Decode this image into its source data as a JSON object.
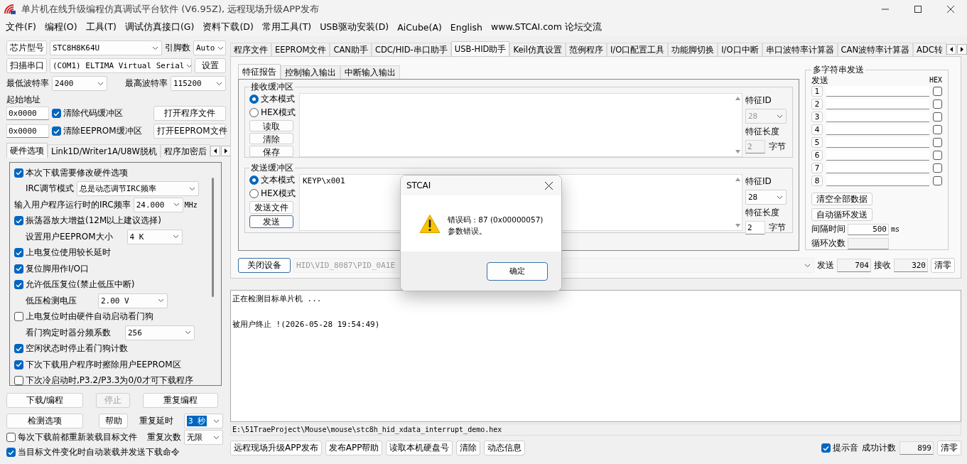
{
  "window": {
    "title": "单片机在线升级编程仿真调试平台软件 (V6.95Z), 远程现场升级APP发布"
  },
  "menu": [
    "文件(F)",
    "编程(O)",
    "工具(T)",
    "调试仿真接口(G)",
    "资料下载(D)",
    "常用工具(T)",
    "USB驱动安装(D)",
    "AiCube(A)",
    "English",
    "www.STCAI.com 论坛交流"
  ],
  "left": {
    "rows": [
      [
        {
          "kind": "button",
          "label": "芯片型号"
        },
        {
          "kind": "select",
          "value": "STC8H8K64U"
        },
        {
          "kind": "label",
          "text": "引脚数"
        },
        {
          "kind": "select",
          "value": "Auto"
        }
      ],
      [
        {
          "kind": "button",
          "label": "扫描串口"
        },
        {
          "kind": "select",
          "value": "(COM1) ELTIMA Virtual Serial"
        },
        {
          "kind": "button",
          "label": "设置"
        }
      ],
      [
        {
          "kind": "label",
          "text": "最低波特率"
        },
        {
          "kind": "select",
          "value": "2400"
        },
        {
          "kind": "label",
          "text": "最高波特率"
        },
        {
          "kind": "select",
          "value": "115200"
        }
      ],
      [
        {
          "kind": "label",
          "text": "起始地址"
        }
      ],
      [
        {
          "kind": "input",
          "value": "0x0000"
        },
        {
          "kind": "check",
          "label": "清除代码缓冲区",
          "checked": true
        },
        {
          "kind": "button",
          "label": "打开程序文件"
        }
      ],
      [
        {
          "kind": "input",
          "value": "0x0000"
        },
        {
          "kind": "check",
          "label": "清除EEPROM缓冲区",
          "checked": true
        },
        {
          "kind": "button",
          "label": "打开EEPROM文件"
        }
      ]
    ],
    "tabs": [
      {
        "label": "硬件选项",
        "selected": true
      },
      {
        "label": "Link1D/Writer1A/U8W脱机",
        "selected": false
      },
      {
        "label": "程序加密后",
        "selected": false
      }
    ],
    "options": [
      {
        "kind": "check",
        "label": "本次下载需要修改硬件选项",
        "checked": true
      },
      {
        "kind": "select",
        "label": "IRC调节模式",
        "value": "总是动态调节IRC频率"
      },
      {
        "kind": "select",
        "label": "输入用户程序运行时的IRC频率",
        "value": "24.000",
        "unit": "MHz"
      },
      {
        "kind": "check",
        "label": "振荡器放大增益(12M以上建议选择)",
        "checked": true
      },
      {
        "kind": "select",
        "label": "设置用户EEPROM大小",
        "value": "4   K"
      },
      {
        "kind": "check",
        "label": "上电复位使用较长延时",
        "checked": true
      },
      {
        "kind": "check",
        "label": "复位脚用作I/O口",
        "checked": true
      },
      {
        "kind": "check",
        "label": "允许低压复位(禁止低压中断)",
        "checked": true
      },
      {
        "kind": "select",
        "label": "低压检测电压",
        "value": "2.00 V"
      },
      {
        "kind": "check",
        "label": "上电复位时由硬件自动启动看门狗",
        "checked": false
      },
      {
        "kind": "select",
        "label": "看门狗定时器分频系数",
        "value": "256"
      },
      {
        "kind": "check",
        "label": "空闲状态时停止看门狗计数",
        "checked": true
      },
      {
        "kind": "check",
        "label": "下次下载用户程序时擦除用户EEPROM区",
        "checked": true
      },
      {
        "kind": "check",
        "label": "下次冷启动时,P3.2/P3.3为0/0才可下载程序",
        "checked": false
      }
    ],
    "actions": [
      [
        {
          "kind": "button",
          "label": "下载/编程",
          "disabled": false
        },
        {
          "kind": "button",
          "label": "停止",
          "disabled": true
        },
        {
          "kind": "button",
          "label": "重复编程",
          "disabled": false
        }
      ],
      [
        {
          "kind": "button",
          "label": "检测选项"
        },
        {
          "kind": "button",
          "label": "帮助"
        },
        {
          "kind": "label",
          "text": "重复延时"
        },
        {
          "kind": "select",
          "value": "3 秒",
          "text_selected": true
        }
      ],
      [
        {
          "kind": "check",
          "label": "每次下载前都重新装载目标文件",
          "checked": false
        },
        {
          "kind": "label",
          "text": "重复次数"
        },
        {
          "kind": "select",
          "value": "无限",
          "text_selected": false
        }
      ],
      [
        {
          "kind": "check",
          "label": "当目标文件变化时自动装载并发送下载命令",
          "checked": true
        }
      ]
    ]
  },
  "right": {
    "tabs": [
      {
        "label": "程序文件",
        "selected": false
      },
      {
        "label": "EEPROM文件",
        "selected": false
      },
      {
        "label": "CAN助手",
        "selected": false
      },
      {
        "label": "CDC/HID-串口助手",
        "selected": false
      },
      {
        "label": "USB-HID助手",
        "selected": true
      },
      {
        "label": "Keil仿真设置",
        "selected": false
      },
      {
        "label": "范例程序",
        "selected": false
      },
      {
        "label": "I/O口配置工具",
        "selected": false
      },
      {
        "label": "功能脚切换",
        "selected": false
      },
      {
        "label": "I/O口中断",
        "selected": false
      },
      {
        "label": "串口波特率计算器",
        "selected": false
      },
      {
        "label": "CAN波特率计算器",
        "selected": false
      },
      {
        "label": "ADC转",
        "selected": false
      }
    ],
    "subtabs": [
      {
        "label": "特征报告",
        "selected": true
      },
      {
        "label": "控制输入输出",
        "selected": false
      },
      {
        "label": "中断输入输出",
        "selected": false
      }
    ],
    "buffers": [
      {
        "title": "接收缓冲区",
        "modes": [
          {
            "label": "文本模式",
            "selected": true
          },
          {
            "label": "HEX模式",
            "selected": false
          }
        ],
        "buttons": [
          {
            "label": "读取",
            "default": false
          },
          {
            "label": "清除",
            "default": false
          },
          {
            "label": "保存",
            "default": false
          }
        ],
        "id_label": "特征ID",
        "id": {
          "value": "28",
          "disabled": true
        },
        "len_label": "特征长度",
        "len": {
          "value": "2",
          "disabled": true
        },
        "unit": "字节"
      },
      {
        "title": "发送缓冲区",
        "modes": [
          {
            "label": "文本模式",
            "selected": true
          },
          {
            "label": "HEX模式",
            "selected": false
          }
        ],
        "buttons": [
          {
            "label": "发送文件",
            "default": false
          },
          {
            "label": "发送",
            "default": true
          }
        ],
        "content": "KEYP\\x001",
        "id_label": "特征ID",
        "id": {
          "value": "28",
          "disabled": false
        },
        "len_label": "特征长度",
        "len": {
          "value": "2",
          "disabled": false
        },
        "unit": "字节"
      }
    ],
    "multi": {
      "title": "多字符串发送",
      "send_header": "发送",
      "hex_header": "HEX",
      "rows": [
        {
          "number": "1",
          "hex": false
        },
        {
          "number": "2",
          "hex": false
        },
        {
          "number": "3",
          "hex": false
        },
        {
          "number": "4",
          "hex": false
        },
        {
          "number": "5",
          "hex": false
        },
        {
          "number": "6",
          "hex": false
        },
        {
          "number": "7",
          "hex": false
        },
        {
          "number": "8",
          "hex": false
        }
      ],
      "buttons": [
        "清空全部数据",
        "自动循环发送"
      ],
      "interval_label": "间隔时间",
      "interval": "500",
      "interval_unit": "ms",
      "count_label": "循环次数"
    },
    "device": {
      "button": "关闭设备",
      "path": "HID\\VID_8087\\PID_0A1E",
      "sent_label": "发送",
      "sent": "704",
      "recv_label": "接收",
      "recv": "320",
      "reset": "清零"
    },
    "log": [
      "正在检测目标单片机 ...",
      "被用户终止 !(2026-05-28 19:54:49)"
    ],
    "file_path": "E:\\51TraeProject\\Mouse\\mouse\\stc8h_hid_xdata_interrupt_demo.hex",
    "bottom": {
      "buttons": [
        "远程现场升级APP发布",
        "发布APP帮助",
        "读取本机硬盘号",
        "清除",
        "动态信息"
      ],
      "beep": {
        "label": "提示音",
        "checked": true
      },
      "count_label": "成功计数",
      "count": "899",
      "reset": "清零"
    }
  },
  "dialog": {
    "title": "STCAI",
    "lines": [
      "错误码 : 87 (0x00000057)",
      "参数错误。"
    ],
    "button": "确定"
  }
}
